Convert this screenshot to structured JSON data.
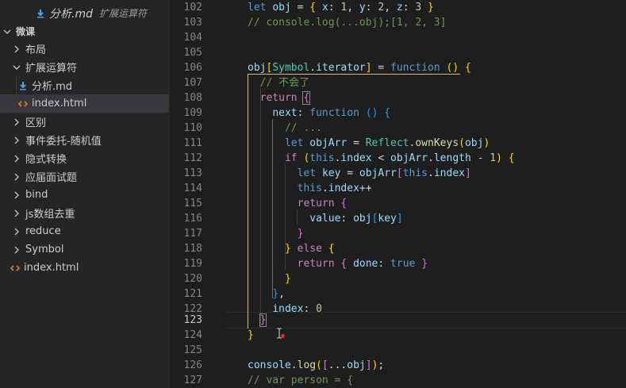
{
  "sidebar": {
    "open_file": {
      "name": "分析.md",
      "description": "扩展运算符"
    },
    "root": {
      "label": "微课"
    },
    "items": [
      {
        "label": "布局",
        "type": "folder",
        "expanded": false
      },
      {
        "label": "扩展运算符",
        "type": "folder",
        "expanded": true
      },
      {
        "label": "分析.md",
        "type": "markdown-file"
      },
      {
        "label": "index.html",
        "type": "html-file",
        "selected": true
      },
      {
        "label": "区别",
        "type": "folder",
        "expanded": false
      },
      {
        "label": "事件委托-随机值",
        "type": "folder",
        "expanded": false
      },
      {
        "label": "隐式转换",
        "type": "folder",
        "expanded": false
      },
      {
        "label": "应届面试题",
        "type": "folder",
        "expanded": false
      },
      {
        "label": "bind",
        "type": "folder",
        "expanded": false
      },
      {
        "label": "js数组去重",
        "type": "folder",
        "expanded": false
      },
      {
        "label": "reduce",
        "type": "folder",
        "expanded": false
      },
      {
        "label": "Symbol",
        "type": "folder",
        "expanded": false
      },
      {
        "label": "index.html",
        "type": "html-file"
      }
    ]
  },
  "editor": {
    "active_line": "123",
    "line_numbers": [
      "102",
      "103",
      "104",
      "105",
      "106",
      "107",
      "108",
      "109",
      "110",
      "111",
      "112",
      "113",
      "114",
      "115",
      "116",
      "117",
      "118",
      "119",
      "120",
      "121",
      "122",
      "123",
      "124",
      "125",
      "126",
      "127"
    ],
    "lines": [
      "let obj = { x: 1, y: 2, z: 3 }",
      "// console.log(...obj);[1, 2, 3]",
      "",
      "",
      "obj[Symbol.iterator] = function () {",
      "  // 不会了",
      "  return {",
      "    next: function () {",
      "      // ...",
      "      let objArr = Reflect.ownKeys(obj)",
      "      if (this.index < objArr.length - 1) {",
      "        let key = objArr[this.index]",
      "        this.index++",
      "        return {",
      "          value: obj[key]",
      "        }",
      "      } else {",
      "        return { done: true }",
      "      }",
      "    },",
      "    index: 0",
      "  }",
      "}",
      "",
      "console.log([...obj]);",
      "// var person = {"
    ]
  },
  "colors": {
    "keyword": "#569cd6",
    "control": "#c586c0",
    "variable": "#9cdcfe",
    "number": "#b5cea8",
    "function": "#dcdcaa",
    "class": "#4ec9b0",
    "comment": "#6a9955",
    "bracket1": "#ffd700",
    "bracket2": "#da70d6",
    "bracket3": "#179fff"
  }
}
